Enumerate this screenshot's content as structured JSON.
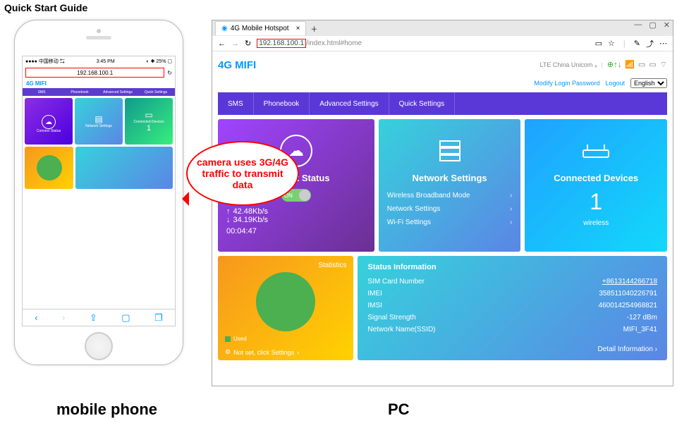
{
  "guide": {
    "title": "Quick Start Guide",
    "label_mobile": "mobile phone",
    "label_pc": "PC"
  },
  "bubble": {
    "text": "camera uses 3G/4G traffic to transmit data"
  },
  "mobile": {
    "carrier": "●●●● 中国移动 ⇆",
    "time": "3:45 PM",
    "battery": "◐ ✱ 25% ▢",
    "url": "192.168.100.1",
    "logo": "4G MIFI",
    "nav": [
      "SMS",
      "Phonebook",
      "Advanced Settings",
      "Quick Settings"
    ],
    "card1_title": "Connect Status",
    "card2_title": "Network Settings",
    "card3_title": "Connected Devices",
    "card3_value": "1"
  },
  "pc": {
    "tab_title": "4G Mobile Hotspot",
    "url_hl": "192.168.100.1",
    "url_rest": "/index.html#home",
    "logo": "4G MIFI",
    "network_label": "LTE   China Unicom ₄",
    "modify": "Modify Login Password",
    "logout": "Logout",
    "lang": "English",
    "nav": {
      "sms": "SMS",
      "pb": "Phonebook",
      "adv": "Advanced Settings",
      "qs": "Quick Settings"
    },
    "connect": {
      "title": "Connect Status",
      "toggle": "ON",
      "up": "42.48Kb/s",
      "down": "34.19Kb/s",
      "time": "00:04:47"
    },
    "net": {
      "title": "Network Settings",
      "items": [
        "Wireless Broadband Mode",
        "Network Settings",
        "Wi-Fi Settings"
      ]
    },
    "dev": {
      "title": "Connected Devices",
      "count": "1",
      "sub": "wireless"
    },
    "stats": {
      "title": "Statistics",
      "legend": "Used",
      "notset": "Not set, click Settings",
      "chev": "›"
    },
    "info": {
      "title": "Status Information",
      "rows": [
        {
          "k": "SIM Card Number",
          "v": "+8613144266718"
        },
        {
          "k": "IMEI",
          "v": "358511040226791"
        },
        {
          "k": "IMSI",
          "v": "460014254968821"
        },
        {
          "k": "Signal Strength",
          "v": "-127 dBm"
        },
        {
          "k": "Network Name(SSID)",
          "v": "MIFI_3F41"
        }
      ],
      "detail": "Detail Information  ›"
    }
  }
}
